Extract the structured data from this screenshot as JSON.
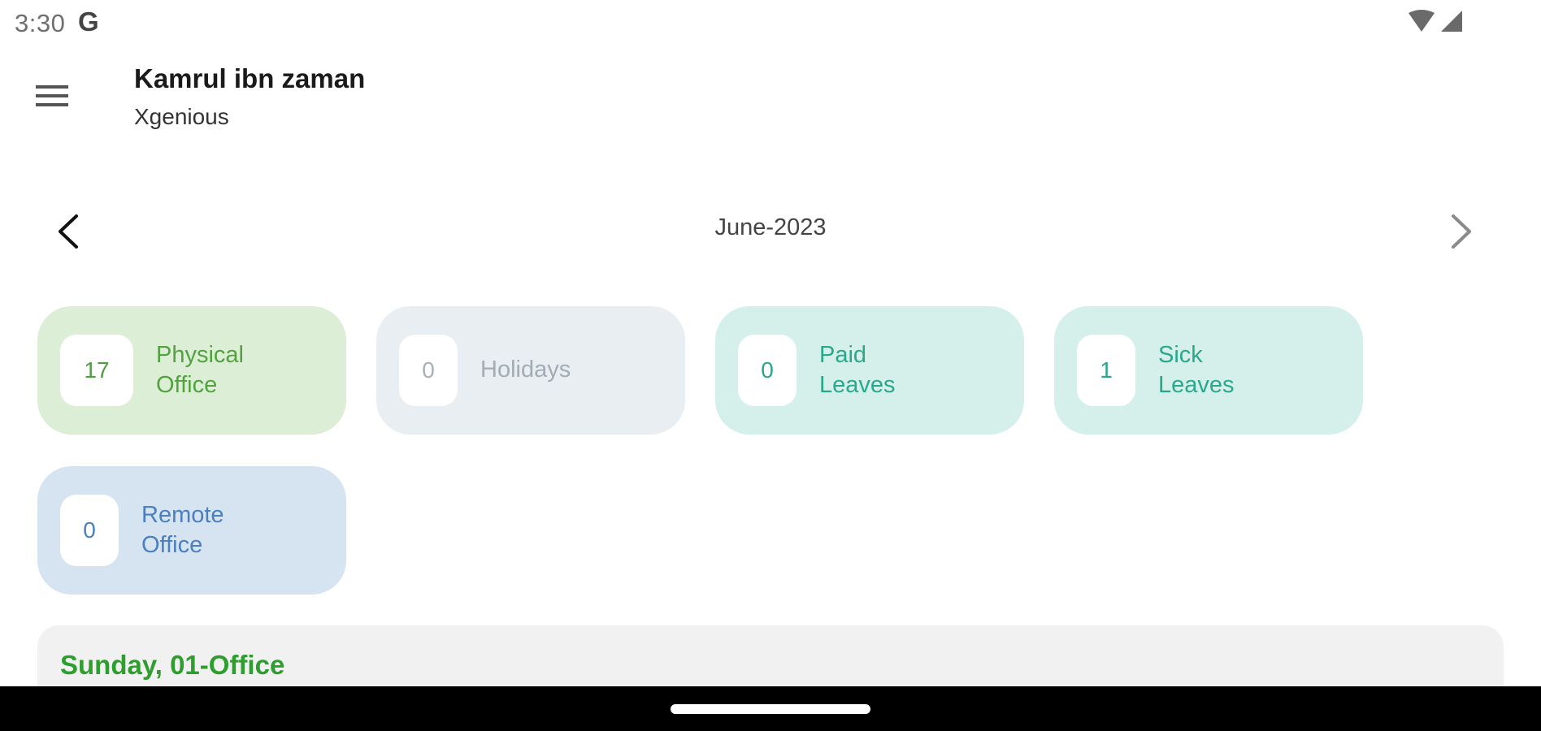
{
  "status_bar": {
    "time": "3:30",
    "google_glyph": "G",
    "icons": [
      "wifi-icon",
      "signal-icon"
    ]
  },
  "header": {
    "menu_icon": "hamburger-menu-icon",
    "user_name": "Kamrul ibn zaman",
    "company": "Xgenious"
  },
  "month_nav": {
    "prev_icon": "chevron-left-icon",
    "next_icon": "chevron-right-icon",
    "label": "June-2023"
  },
  "summary_cards": [
    {
      "key": "physical",
      "count": "17",
      "label": "Physical\nOffice",
      "color": "#52a340",
      "background": "#dcefd6"
    },
    {
      "key": "holidays",
      "count": "0",
      "label": "Holidays",
      "color": "#a2acb4",
      "background": "#e9eef2"
    },
    {
      "key": "paid",
      "count": "0",
      "label": "Paid\nLeaves",
      "color": "#2aa88c",
      "background": "#d5f0ea"
    },
    {
      "key": "sick",
      "count": "1",
      "label": "Sick\nLeaves",
      "color": "#2aa88c",
      "background": "#d5f0ea"
    },
    {
      "key": "remote",
      "count": "0",
      "label": "Remote\nOffice",
      "color": "#4a7fc0",
      "background": "#d6e4f1"
    }
  ],
  "day_list": {
    "items": [
      {
        "title": "Sunday, 01-Office",
        "color": "#2e9e2e"
      }
    ]
  }
}
